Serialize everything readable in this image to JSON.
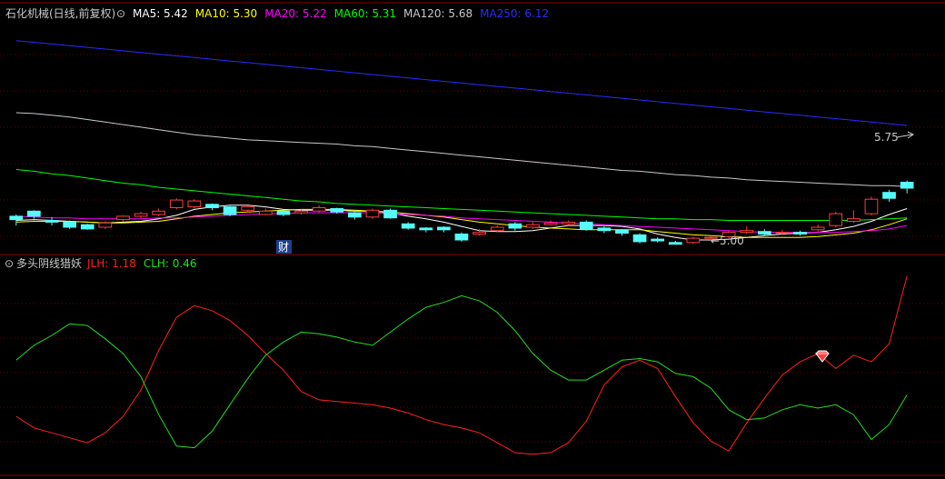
{
  "colors": {
    "background": "#000000",
    "frame": "#8b0000",
    "grid": "#6b0000",
    "up": "#ff3c3c",
    "down": "#54fcfc",
    "ma5": "#ffffff",
    "ma10": "#ffff00",
    "ma20": "#ff00ff",
    "ma60": "#00ff00",
    "ma120": "#c8c8c8",
    "ma250": "#2a2aff",
    "jlh": "#ff2020",
    "clh": "#20e020"
  },
  "top_panel": {
    "title": "石化机械(日线,前复权)",
    "legend": [
      {
        "name": "MA5",
        "label": "MA5: 5.42",
        "color": "#ffffff"
      },
      {
        "name": "MA10",
        "label": "MA10: 5.30",
        "color": "#ffff00"
      },
      {
        "name": "MA20",
        "label": "MA20: 5.22",
        "color": "#ff00ff"
      },
      {
        "name": "MA60",
        "label": "MA60: 5.31",
        "color": "#00ff00"
      },
      {
        "name": "MA120",
        "label": "MA120: 5.68",
        "color": "#c8c8c8"
      },
      {
        "name": "MA250",
        "label": "MA250: 6.12",
        "color": "#2a2aff"
      }
    ],
    "high_marker": "5.75",
    "low_marker": "←5.00",
    "event_badge": "财"
  },
  "bottom_panel": {
    "title": "多头阴线猎妖",
    "legend": [
      {
        "name": "JLH",
        "label": "JLH: 1.18",
        "color": "#ff2020"
      },
      {
        "name": "CLH",
        "label": "CLH: 0.46",
        "color": "#20e020"
      }
    ]
  },
  "chart_data": [
    {
      "type": "candlestick",
      "title": "石化机械(日线,前复权)",
      "ylim": [
        4.9,
        7.6
      ],
      "x": [
        0,
        1,
        2,
        3,
        4,
        5,
        6,
        7,
        8,
        9,
        10,
        11,
        12,
        13,
        14,
        15,
        16,
        17,
        18,
        19,
        20,
        21,
        22,
        23,
        24,
        25,
        26,
        27,
        28,
        29,
        30,
        31,
        32,
        33,
        34,
        35,
        36,
        37,
        38,
        39,
        40,
        41,
        42,
        43,
        44,
        45,
        46,
        47,
        48,
        49,
        50
      ],
      "open": [
        5.33,
        5.39,
        5.28,
        5.26,
        5.23,
        5.2,
        5.29,
        5.33,
        5.35,
        5.43,
        5.44,
        5.47,
        5.44,
        5.4,
        5.35,
        5.39,
        5.37,
        5.39,
        5.42,
        5.37,
        5.32,
        5.4,
        5.24,
        5.19,
        5.2,
        5.12,
        5.12,
        5.16,
        5.24,
        5.2,
        5.23,
        5.24,
        5.26,
        5.19,
        5.17,
        5.11,
        5.06,
        5.02,
        5.02,
        5.07,
        5.09,
        5.14,
        5.15,
        5.14,
        5.14,
        5.17,
        5.22,
        5.27,
        5.36,
        5.61,
        5.73
      ],
      "close": [
        5.29,
        5.33,
        5.26,
        5.2,
        5.18,
        5.25,
        5.33,
        5.36,
        5.39,
        5.52,
        5.51,
        5.43,
        5.35,
        5.44,
        5.39,
        5.35,
        5.39,
        5.43,
        5.38,
        5.32,
        5.4,
        5.31,
        5.19,
        5.17,
        5.17,
        5.05,
        5.14,
        5.2,
        5.19,
        5.23,
        5.25,
        5.26,
        5.18,
        5.16,
        5.13,
        5.03,
        5.04,
        5.0,
        5.07,
        5.08,
        5.14,
        5.16,
        5.12,
        5.14,
        5.12,
        5.2,
        5.36,
        5.3,
        5.53,
        5.54,
        5.66
      ],
      "high": [
        5.35,
        5.4,
        5.32,
        5.28,
        5.24,
        5.27,
        5.34,
        5.38,
        5.42,
        5.54,
        5.53,
        5.48,
        5.45,
        5.45,
        5.42,
        5.4,
        5.41,
        5.46,
        5.43,
        5.38,
        5.42,
        5.42,
        5.26,
        5.2,
        5.21,
        5.14,
        5.18,
        5.22,
        5.26,
        5.26,
        5.28,
        5.28,
        5.28,
        5.21,
        5.18,
        5.13,
        5.08,
        5.04,
        5.09,
        5.1,
        5.16,
        5.21,
        5.18,
        5.17,
        5.16,
        5.23,
        5.38,
        5.4,
        5.56,
        5.64,
        5.75
      ],
      "low": [
        5.22,
        5.3,
        5.22,
        5.18,
        5.17,
        5.18,
        5.27,
        5.31,
        5.33,
        5.41,
        5.42,
        5.4,
        5.33,
        5.37,
        5.34,
        5.33,
        5.35,
        5.37,
        5.36,
        5.29,
        5.3,
        5.3,
        5.17,
        5.14,
        5.14,
        5.03,
        5.1,
        5.14,
        5.16,
        5.18,
        5.22,
        5.22,
        5.16,
        5.13,
        5.1,
        5.01,
        5.02,
        5.0,
        5.0,
        5.05,
        5.07,
        5.12,
        5.1,
        5.11,
        5.1,
        5.15,
        5.2,
        5.25,
        5.34,
        5.5,
        5.6
      ],
      "series": [
        {
          "name": "MA5",
          "values": [
            5.28,
            5.29,
            5.28,
            5.27,
            5.26,
            5.25,
            5.26,
            5.27,
            5.3,
            5.34,
            5.41,
            5.44,
            5.46,
            5.46,
            5.44,
            5.41,
            5.4,
            5.4,
            5.4,
            5.39,
            5.39,
            5.37,
            5.33,
            5.3,
            5.26,
            5.21,
            5.16,
            5.15,
            5.15,
            5.16,
            5.19,
            5.22,
            5.22,
            5.22,
            5.21,
            5.18,
            5.12,
            5.08,
            5.05,
            5.05,
            5.06,
            5.08,
            5.1,
            5.12,
            5.13,
            5.14,
            5.17,
            5.21,
            5.27,
            5.35,
            5.42
          ]
        },
        {
          "name": "MA10",
          "values": [
            5.26,
            5.27,
            5.27,
            5.27,
            5.26,
            5.25,
            5.25,
            5.26,
            5.27,
            5.3,
            5.33,
            5.35,
            5.37,
            5.38,
            5.39,
            5.4,
            5.41,
            5.41,
            5.41,
            5.4,
            5.39,
            5.38,
            5.36,
            5.34,
            5.32,
            5.29,
            5.26,
            5.24,
            5.22,
            5.2,
            5.19,
            5.18,
            5.17,
            5.17,
            5.17,
            5.17,
            5.15,
            5.13,
            5.11,
            5.1,
            5.09,
            5.08,
            5.08,
            5.08,
            5.08,
            5.09,
            5.11,
            5.13,
            5.17,
            5.23,
            5.3
          ]
        },
        {
          "name": "MA20",
          "values": [
            5.33,
            5.32,
            5.31,
            5.31,
            5.3,
            5.3,
            5.3,
            5.3,
            5.31,
            5.31,
            5.32,
            5.33,
            5.34,
            5.35,
            5.36,
            5.36,
            5.37,
            5.37,
            5.37,
            5.37,
            5.37,
            5.36,
            5.35,
            5.34,
            5.33,
            5.31,
            5.3,
            5.29,
            5.28,
            5.27,
            5.26,
            5.25,
            5.24,
            5.23,
            5.22,
            5.21,
            5.2,
            5.19,
            5.18,
            5.17,
            5.16,
            5.15,
            5.14,
            5.14,
            5.14,
            5.14,
            5.14,
            5.15,
            5.16,
            5.18,
            5.22
          ]
        },
        {
          "name": "MA60",
          "values": [
            5.88,
            5.86,
            5.83,
            5.81,
            5.78,
            5.75,
            5.72,
            5.7,
            5.67,
            5.65,
            5.63,
            5.61,
            5.59,
            5.57,
            5.55,
            5.53,
            5.51,
            5.5,
            5.48,
            5.47,
            5.46,
            5.45,
            5.44,
            5.43,
            5.42,
            5.41,
            5.4,
            5.39,
            5.38,
            5.37,
            5.36,
            5.35,
            5.34,
            5.33,
            5.32,
            5.31,
            5.3,
            5.3,
            5.29,
            5.29,
            5.28,
            5.28,
            5.28,
            5.28,
            5.28,
            5.28,
            5.28,
            5.28,
            5.29,
            5.3,
            5.31
          ]
        },
        {
          "name": "MA120",
          "values": [
            6.55,
            6.54,
            6.52,
            6.5,
            6.47,
            6.44,
            6.41,
            6.38,
            6.35,
            6.32,
            6.29,
            6.27,
            6.25,
            6.23,
            6.22,
            6.21,
            6.2,
            6.19,
            6.18,
            6.16,
            6.15,
            6.13,
            6.11,
            6.09,
            6.07,
            6.05,
            6.03,
            6.01,
            5.99,
            5.97,
            5.95,
            5.93,
            5.91,
            5.89,
            5.87,
            5.86,
            5.84,
            5.82,
            5.81,
            5.79,
            5.78,
            5.76,
            5.75,
            5.74,
            5.73,
            5.72,
            5.71,
            5.7,
            5.69,
            5.69,
            5.68
          ]
        },
        {
          "name": "MA250",
          "values": [
            7.4,
            7.38,
            7.36,
            7.34,
            7.32,
            7.3,
            7.28,
            7.26,
            7.24,
            7.22,
            7.2,
            7.18,
            7.16,
            7.14,
            7.12,
            7.1,
            7.08,
            7.06,
            7.04,
            7.02,
            7.0,
            6.98,
            6.96,
            6.94,
            6.92,
            6.9,
            6.88,
            6.86,
            6.84,
            6.82,
            6.8,
            6.78,
            6.76,
            6.74,
            6.72,
            6.7,
            6.68,
            6.66,
            6.64,
            6.62,
            6.6,
            6.58,
            6.56,
            6.54,
            6.52,
            6.5,
            6.48,
            6.46,
            6.44,
            6.42,
            6.4
          ]
        }
      ]
    },
    {
      "type": "line",
      "title": "多头阴线猎妖",
      "ylim": [
        0,
        1.2
      ],
      "x": [
        0,
        1,
        2,
        3,
        4,
        5,
        6,
        7,
        8,
        9,
        10,
        11,
        12,
        13,
        14,
        15,
        16,
        17,
        18,
        19,
        20,
        21,
        22,
        23,
        24,
        25,
        26,
        27,
        28,
        29,
        30,
        31,
        32,
        33,
        34,
        35,
        36,
        37,
        38,
        39,
        40,
        41,
        42,
        43,
        44,
        45,
        46,
        47,
        48,
        49,
        50
      ],
      "series": [
        {
          "name": "JLH",
          "values": [
            0.33,
            0.26,
            0.23,
            0.2,
            0.17,
            0.23,
            0.33,
            0.49,
            0.73,
            0.93,
            1.0,
            0.97,
            0.91,
            0.82,
            0.71,
            0.61,
            0.48,
            0.43,
            0.42,
            0.41,
            0.4,
            0.38,
            0.35,
            0.31,
            0.28,
            0.26,
            0.23,
            0.17,
            0.11,
            0.1,
            0.11,
            0.17,
            0.3,
            0.52,
            0.63,
            0.67,
            0.62,
            0.45,
            0.29,
            0.18,
            0.12,
            0.29,
            0.44,
            0.58,
            0.66,
            0.71,
            0.62,
            0.7,
            0.66,
            0.77,
            1.18
          ]
        },
        {
          "name": "CLH",
          "values": [
            0.67,
            0.76,
            0.82,
            0.89,
            0.88,
            0.8,
            0.71,
            0.57,
            0.34,
            0.15,
            0.14,
            0.24,
            0.4,
            0.56,
            0.7,
            0.78,
            0.84,
            0.83,
            0.81,
            0.78,
            0.76,
            0.84,
            0.92,
            0.99,
            1.02,
            1.06,
            1.03,
            0.96,
            0.85,
            0.71,
            0.61,
            0.55,
            0.55,
            0.61,
            0.67,
            0.68,
            0.66,
            0.59,
            0.57,
            0.5,
            0.37,
            0.31,
            0.32,
            0.37,
            0.4,
            0.38,
            0.4,
            0.34,
            0.19,
            0.28,
            0.46
          ]
        }
      ]
    }
  ]
}
